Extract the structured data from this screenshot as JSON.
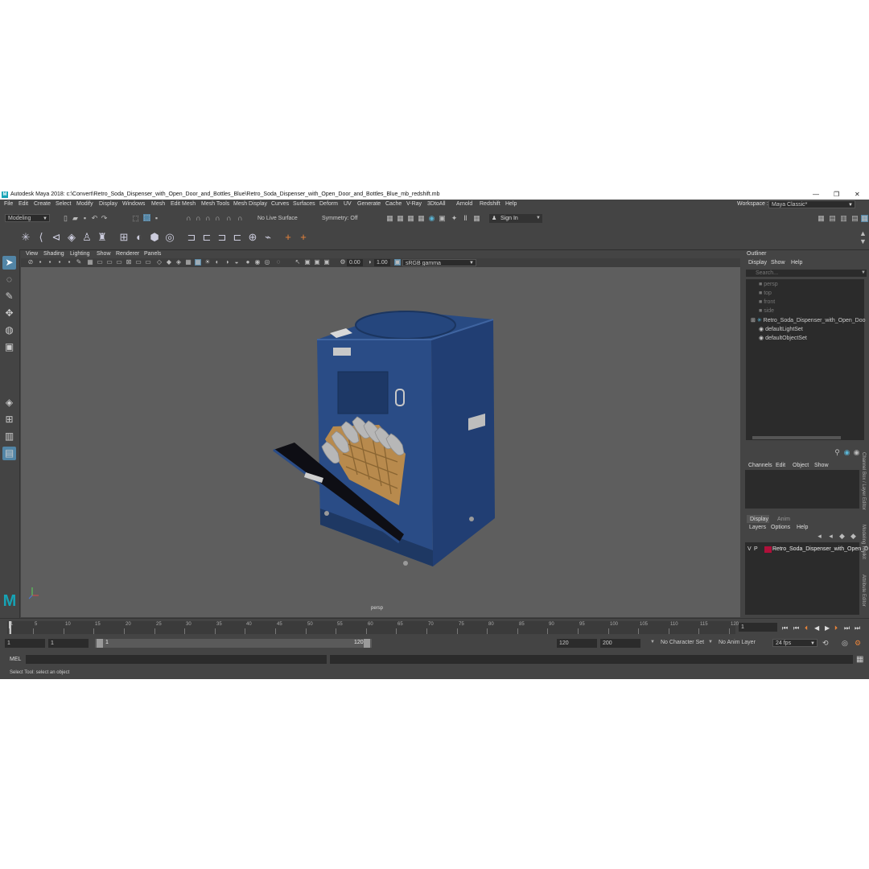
{
  "window": {
    "title": "Autodesk Maya 2018: c:\\Convert\\Retro_Soda_Dispenser_with_Open_Door_and_Bottles_Blue\\Retro_Soda_Dispenser_with_Open_Door_and_Bottles_Blue_mb_redshift.mb",
    "logo": "M",
    "controls": [
      "—",
      "❐",
      "✕"
    ]
  },
  "menubar": {
    "items": [
      "File",
      "Edit",
      "Create",
      "Select",
      "Modify",
      "Display",
      "Windows",
      "Mesh",
      "Edit Mesh",
      "Mesh Tools",
      "Mesh Display",
      "Curves",
      "Surfaces",
      "Deform",
      "UV",
      "Generate",
      "Cache",
      "V-Ray",
      "3DtoAll",
      "Arnold",
      "Redshift",
      "Help"
    ],
    "workspace_label": "Workspace :",
    "workspace_value": "Maya Classic*"
  },
  "statusline": {
    "menuset": "Modeling",
    "live_surface": "No Live Surface",
    "symmetry": "Symmetry: Off",
    "sign_in": "Sign In"
  },
  "viewport": {
    "menu": [
      "View",
      "Shading",
      "Lighting",
      "Show",
      "Renderer",
      "Panels"
    ],
    "exposure": "0.00",
    "gamma": "1.00",
    "color_space": "sRGB gamma",
    "camera_label": "persp"
  },
  "outliner": {
    "title": "Outliner",
    "menu": [
      "Display",
      "Show",
      "Help"
    ],
    "search_placeholder": "Search...",
    "items": [
      {
        "label": "persp",
        "dim": true
      },
      {
        "label": "top",
        "dim": true
      },
      {
        "label": "front",
        "dim": true
      },
      {
        "label": "side",
        "dim": true
      },
      {
        "label": "Retro_Soda_Dispenser_with_Open_Doo",
        "dim": false
      },
      {
        "label": "defaultLightSet",
        "dim": false
      },
      {
        "label": "defaultObjectSet",
        "dim": false
      }
    ]
  },
  "channelbox": {
    "menu": [
      "Channels",
      "Edit",
      "Object",
      "Show"
    ]
  },
  "layers": {
    "tabs": [
      "Display",
      "Anim"
    ],
    "menu": [
      "Layers",
      "Options",
      "Help"
    ],
    "layer_row": {
      "v": "V",
      "p": "P",
      "name": "Retro_Soda_Dispenser_with_Open_D",
      "color": "#b0103a"
    }
  },
  "side_tabs": [
    "Channel Box / Layer Editor",
    "Modeling Toolkit",
    "Attribute Editor"
  ],
  "timeslider": {
    "ticks": [
      "1",
      "5",
      "10",
      "15",
      "20",
      "25",
      "30",
      "35",
      "40",
      "45",
      "50",
      "55",
      "60",
      "65",
      "70",
      "75",
      "80",
      "85",
      "90",
      "95",
      "100",
      "105",
      "110",
      "115",
      "120"
    ],
    "current_frame": "1"
  },
  "range": {
    "start": "1",
    "anim_start": "1",
    "slider_start": "1",
    "slider_end": "120",
    "end": "120",
    "anim_end": "200",
    "character_set": "No Character Set",
    "anim_layer": "No Anim Layer",
    "fps": "24 fps"
  },
  "cmdline": {
    "lang": "MEL"
  },
  "helpline": {
    "text": "Select Tool: select an object"
  },
  "colors": {
    "accent": "#16a3b5",
    "dispenser": "#1f3d73",
    "crate": "#b88a4d",
    "viewport_bg": "#5e5e5e"
  }
}
